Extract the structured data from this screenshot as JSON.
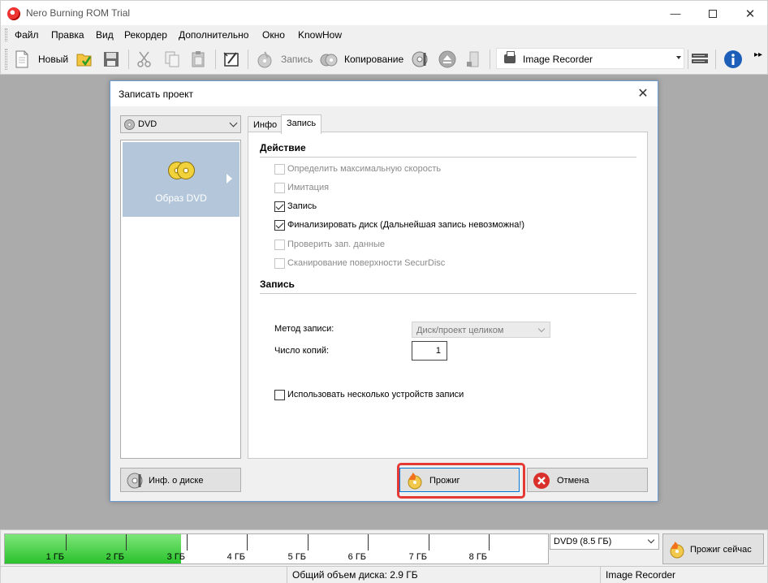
{
  "window": {
    "title": "Nero Burning ROM Trial"
  },
  "menu": [
    "Файл",
    "Правка",
    "Вид",
    "Рекордер",
    "Дополнительно",
    "Окно",
    "KnowHow"
  ],
  "toolbar": {
    "new_label": "Новый",
    "burn_label": "Запись",
    "copy_label": "Копирование",
    "recorder": "Image Recorder"
  },
  "dialog": {
    "title": "Записать проект",
    "disc_type": "DVD",
    "project_item": "Образ DVD",
    "tabs": [
      "Инфо",
      "Запись"
    ],
    "action_section": "Действие",
    "options": [
      {
        "label": "Определить максимальную скорость",
        "checked": false,
        "enabled": false
      },
      {
        "label": "Имитация",
        "checked": false,
        "enabled": false
      },
      {
        "label": "Запись",
        "checked": true,
        "enabled": true
      },
      {
        "label": "Финализировать диск (Дальнейшая запись невозможна!)",
        "checked": true,
        "enabled": true
      },
      {
        "label": "Проверить зап. данные",
        "checked": false,
        "enabled": false
      },
      {
        "label": "Сканирование поверхности SecurDisc",
        "checked": false,
        "enabled": false
      }
    ],
    "write_section": "Запись",
    "method_label": "Метод записи:",
    "method_value": "Диск/проект целиком",
    "copies_label": "Число копий:",
    "copies_value": "1",
    "multi_devices": {
      "label": "Использовать несколько устройств записи",
      "checked": false
    },
    "disc_info_btn": "Инф. о диске",
    "burn_btn": "Прожиг",
    "cancel_btn": "Отмена"
  },
  "capacity": {
    "ticks": [
      "1 ГБ",
      "2 ГБ",
      "3 ГБ",
      "4 ГБ",
      "5 ГБ",
      "6 ГБ",
      "7 ГБ",
      "8 ГБ"
    ],
    "used_gb": 2.9,
    "disc_select": "DVD9 (8.5 ГБ)",
    "burn_now": "Прожиг сейчас"
  },
  "status": {
    "total": "Общий объем диска: 2.9 ГБ",
    "recorder": "Image Recorder"
  },
  "colors": {
    "accent_ring": "#e53935",
    "fill_green": "#29c22b",
    "selection": "#b4c6d9"
  }
}
